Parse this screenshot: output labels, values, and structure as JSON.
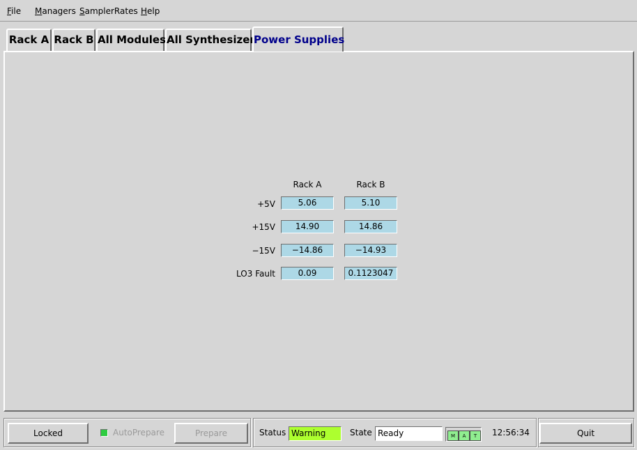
{
  "menu": [
    {
      "mnemonic": "F",
      "rest": "ile"
    },
    {
      "mnemonic": "M",
      "rest": "anagers"
    },
    {
      "mnemonic": "S",
      "rest": "amplerRates"
    },
    {
      "mnemonic": "H",
      "rest": "elp"
    }
  ],
  "tabs": [
    "Rack A",
    "Rack B",
    "All Modules",
    "All Synthesizers",
    "Power Supplies"
  ],
  "active_tab": "Power Supplies",
  "power_table": {
    "columns": [
      "Rack A",
      "Rack B"
    ],
    "rows": [
      {
        "label": "+5V",
        "rack_a": "5.06",
        "rack_b": "5.10"
      },
      {
        "label": "+15V",
        "rack_a": "14.90",
        "rack_b": "14.86"
      },
      {
        "label": "−15V",
        "rack_a": "−14.86",
        "rack_b": "−14.93"
      },
      {
        "label": "LO3 Fault",
        "rack_a": "0.09",
        "rack_b": "0.1123047"
      }
    ]
  },
  "bottom": {
    "locked_label": "Locked",
    "autoprepare_label": "AutoPrepare",
    "prepare_label": "Prepare",
    "status_label": "Status",
    "status_value": "Warning",
    "state_label": "State",
    "state_value": "Ready",
    "indicators": [
      "M",
      "A",
      "T"
    ],
    "time": "12:56:34",
    "quit_label": "Quit"
  },
  "colors": {
    "field_bg": "#add8e6",
    "warning_bg": "#adff2f",
    "indicator_bg": "#90ee90",
    "active_tab_text": "#00008b"
  }
}
